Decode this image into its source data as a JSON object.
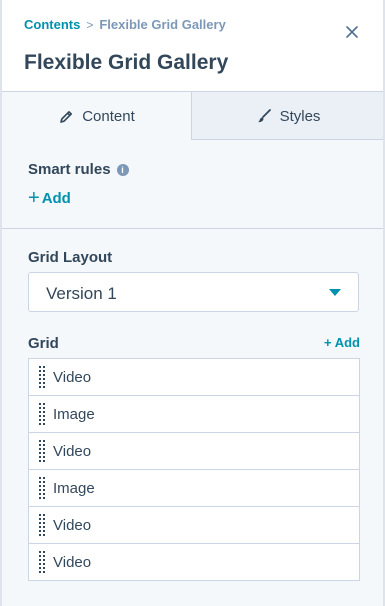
{
  "breadcrumb": {
    "parent": "Contents",
    "separator": ">",
    "current": "Flexible Grid Gallery"
  },
  "title": "Flexible Grid Gallery",
  "tabs": [
    {
      "label": "Content",
      "icon": "pencil-icon",
      "active": true
    },
    {
      "label": "Styles",
      "icon": "brush-icon",
      "active": false
    }
  ],
  "smart_rules": {
    "label": "Smart rules",
    "info_glyph": "i",
    "add_label": "Add",
    "add_glyph": "+"
  },
  "grid_layout": {
    "label": "Grid Layout",
    "value": "Version 1"
  },
  "grid": {
    "label": "Grid",
    "add_label": "+ Add",
    "items": [
      "Video",
      "Image",
      "Video",
      "Image",
      "Video",
      "Video"
    ]
  },
  "colors": {
    "accent": "#0091ae",
    "text": "#33475b",
    "muted": "#7c98b6",
    "border": "#cbd6e2",
    "panel_bg": "#f5f8fa"
  }
}
